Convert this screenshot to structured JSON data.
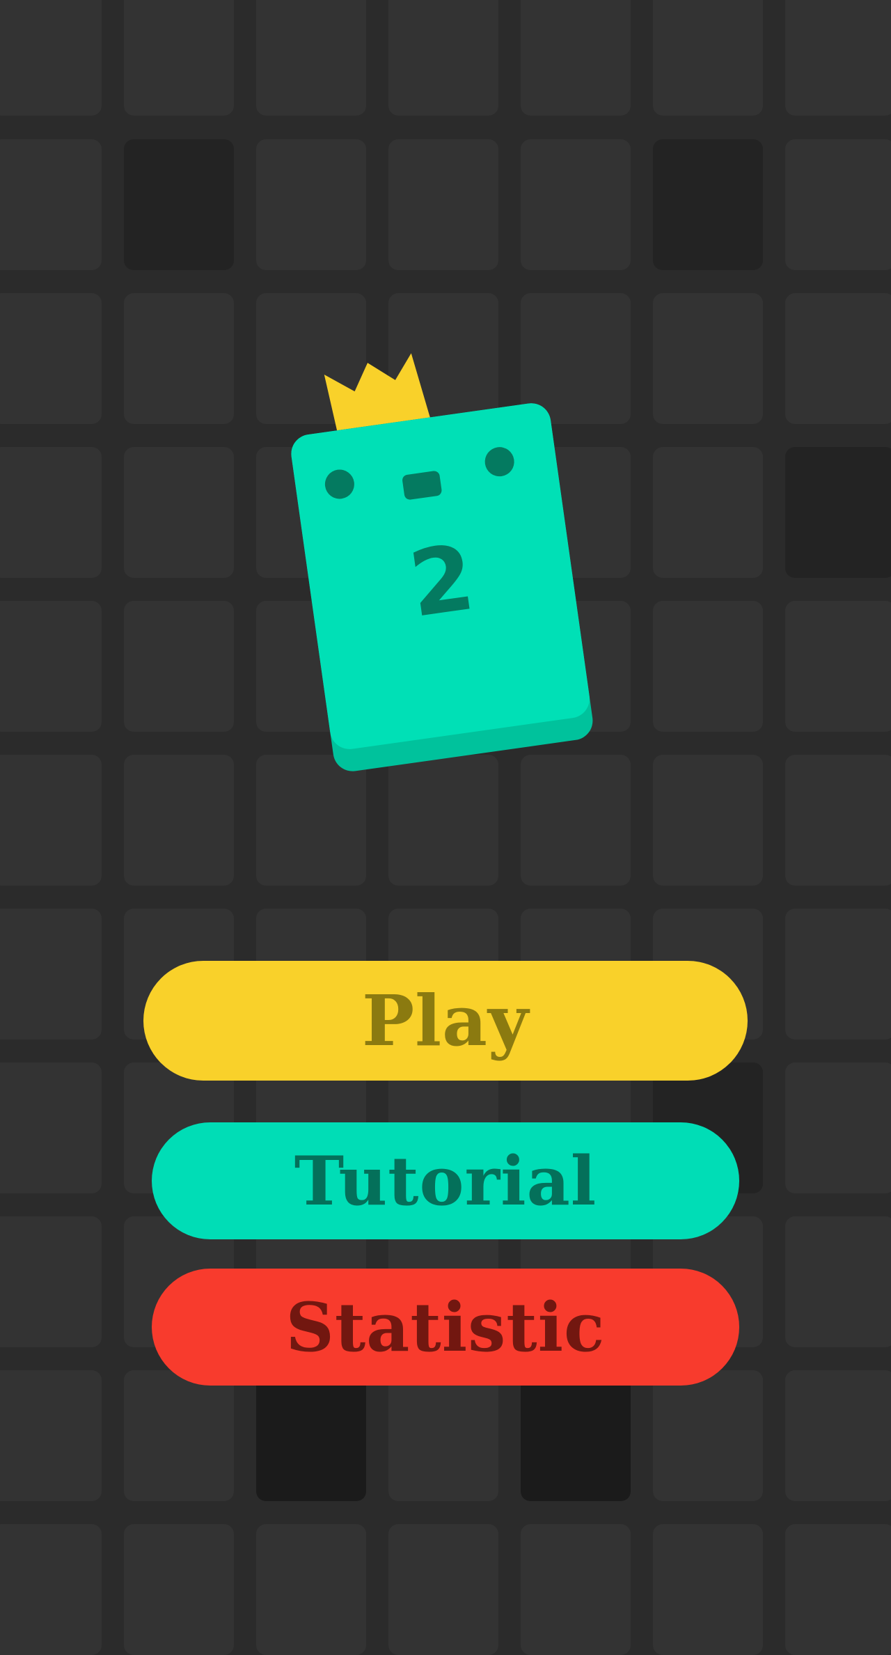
{
  "colors": {
    "background": "#2b2b2b",
    "tile": "#333333",
    "tile_dark": "#232323",
    "tile_darker": "#1b1b1b",
    "mascot_body": "#00e0b6",
    "mascot_shadow": "#00c29c",
    "mascot_features": "#047a60",
    "crown": "#f9d12a",
    "play_bg": "#f9d12a",
    "play_text": "#8b7a10",
    "tutorial_bg": "#00ddb6",
    "tutorial_text": "#04705a",
    "statistic_bg": "#f83b2d",
    "statistic_text": "#721710"
  },
  "board": {
    "highlighted_tiles": [
      {
        "row": 1,
        "col": 1,
        "shade": "dark"
      },
      {
        "row": 1,
        "col": 5,
        "shade": "dark"
      },
      {
        "row": 3,
        "col": 6,
        "shade": "dark"
      },
      {
        "row": 7,
        "col": 5,
        "shade": "dark"
      },
      {
        "row": 9,
        "col": 2,
        "shade": "darker"
      },
      {
        "row": 9,
        "col": 4,
        "shade": "darker"
      }
    ]
  },
  "mascot": {
    "number": "2",
    "crown_icon": "crown-icon"
  },
  "menu": {
    "play_label": "Play",
    "tutorial_label": "Tutorial",
    "statistic_label": "Statistic"
  }
}
